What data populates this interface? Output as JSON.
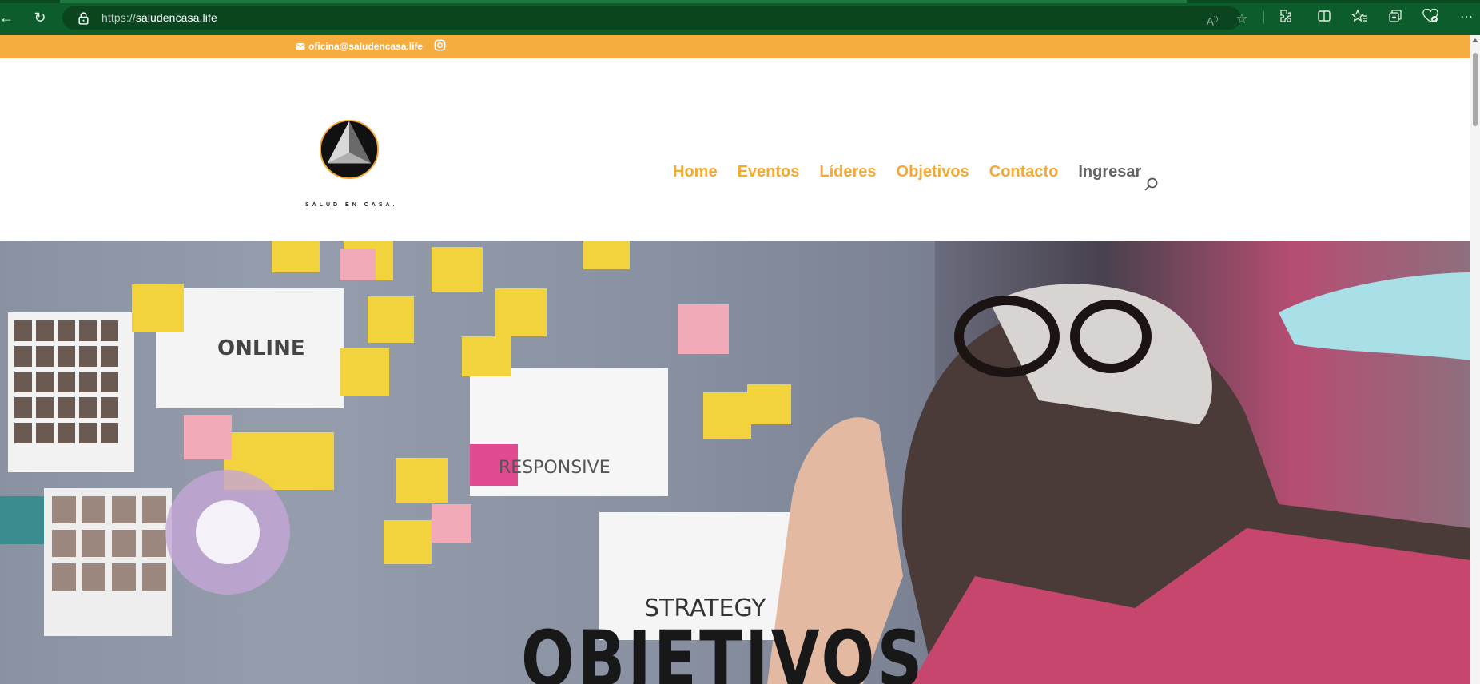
{
  "browser": {
    "url_scheme": "https://",
    "url_host": "saludencasa.life",
    "read_aloud_icon": "read-aloud-icon",
    "favorite_icon": "star-icon",
    "toolbar_icons": [
      "extensions-icon",
      "split-screen-icon",
      "favorites-icon",
      "collections-icon",
      "browser-essentials-icon",
      "more-icon"
    ]
  },
  "topbar": {
    "email": "oficina@saludencasa.life",
    "background": "#f5ad3f"
  },
  "header": {
    "logo_subtitle": "SALUD EN CASA.",
    "nav": [
      {
        "label": "Home",
        "color": "#f4a934"
      },
      {
        "label": "Eventos",
        "color": "#f4a934"
      },
      {
        "label": "Líderes",
        "color": "#f4a934"
      },
      {
        "label": "Objetivos",
        "color": "#f4a934"
      },
      {
        "label": "Contacto",
        "color": "#f4a934"
      },
      {
        "label": "Ingresar",
        "color": "#646464"
      }
    ]
  },
  "hero": {
    "title": "OBJETIVOS",
    "board_notes": [
      "ONLINE",
      "RESPONSIVE",
      "STRATEGY"
    ]
  }
}
